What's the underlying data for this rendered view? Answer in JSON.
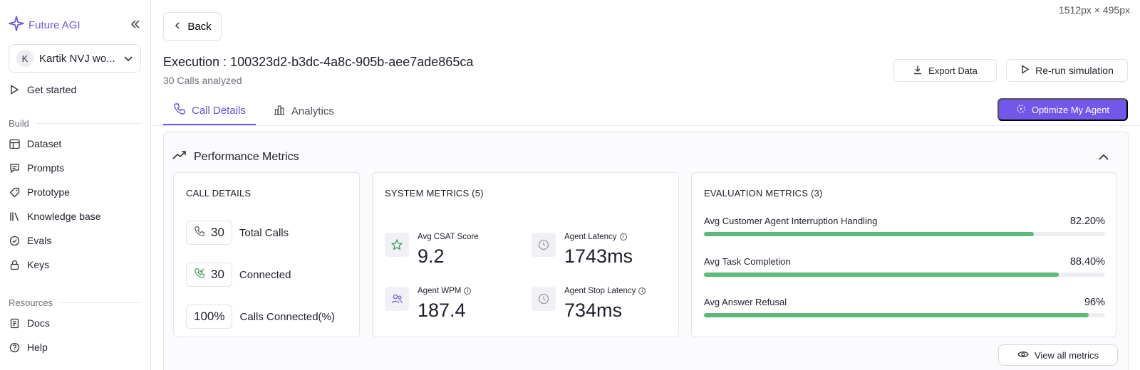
{
  "sidebar": {
    "brand": "Future AGI",
    "workspace": {
      "initial": "K",
      "name": "Kartik NVJ wo..."
    },
    "get_started": "Get started",
    "build_label": "Build",
    "build_items": [
      "Dataset",
      "Prompts",
      "Prototype",
      "Knowledge base",
      "Evals",
      "Keys"
    ],
    "resources_label": "Resources",
    "resource_items": [
      "Docs",
      "Help"
    ]
  },
  "screen_dims": "1512px × 495px",
  "header": {
    "back_label": "Back",
    "execution_title": "Execution : 100323d2-b3dc-4a8c-905b-aee7ade865ca",
    "subtitle": "30 Calls analyzed",
    "export_label": "Export Data",
    "rerun_label": "Re-run simulation",
    "optimize_label": "Optimize My Agent"
  },
  "tabs": [
    {
      "label": "Call Details",
      "active": true
    },
    {
      "label": "Analytics",
      "active": false
    }
  ],
  "performance": {
    "title": "Performance Metrics",
    "call_details": {
      "title": "CALL DETAILS",
      "rows": [
        {
          "value": "30",
          "label": "Total Calls"
        },
        {
          "value": "30",
          "label": "Connected"
        },
        {
          "value": "100%",
          "label": "Calls Connected(%)"
        }
      ]
    },
    "system_metrics": {
      "title": "SYSTEM METRICS (5)",
      "items": [
        {
          "label": "Avg CSAT Score",
          "value": "9.2",
          "icon": "star-icon"
        },
        {
          "label": "Agent Latency",
          "value": "1743ms",
          "icon": "clock-icon"
        },
        {
          "label": "Agent WPM",
          "value": "187.4",
          "icon": "users-icon"
        },
        {
          "label": "Agent Stop Latency",
          "value": "734ms",
          "icon": "clock-icon"
        }
      ]
    },
    "evaluation_metrics": {
      "title": "EVALUATION METRICS (3)",
      "items": [
        {
          "label": "Avg Customer Agent Interruption Handling",
          "value": "82.20%",
          "fraction": 0.822
        },
        {
          "label": "Avg Task Completion",
          "value": "88.40%",
          "fraction": 0.884
        },
        {
          "label": "Avg Answer Refusal",
          "value": "96%",
          "fraction": 0.96
        }
      ]
    },
    "view_all_label": "View all metrics"
  },
  "colors": {
    "accent": "#7356ea",
    "progress": "#5cb97a"
  }
}
